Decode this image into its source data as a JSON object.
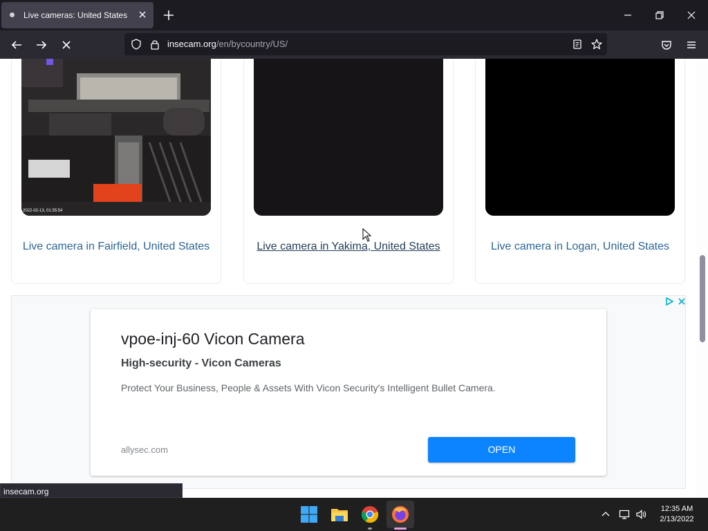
{
  "browser": {
    "tab_title": "Live cameras: United States",
    "url_domain": "insecam.org",
    "url_path": "/en/bycountry/US/"
  },
  "cameras": [
    {
      "label": "Live camera in Fairfield, United States",
      "overlay_timestamp": "2022-02-13, 01:35:54"
    },
    {
      "label": "Live camera in Yakima, United States"
    },
    {
      "label": "Live camera in Logan, United States"
    }
  ],
  "ad": {
    "title": "vpoe-inj-60 Vicon Camera",
    "subtitle": "High-security - Vicon Cameras",
    "description": "Protect Your Business, People & Assets With Vicon Security's Intelligent Bullet Camera.",
    "domain": "allysec.com",
    "button_label": "OPEN"
  },
  "status_bar": {
    "text": "insecam.org"
  },
  "taskbar": {
    "time": "12:35 AM",
    "date": "2/13/2022"
  },
  "colors": {
    "link": "#2a6496",
    "ad_button": "#0d84ff",
    "tab_bar": "#1c1b22",
    "nav_bar": "#2b2a33"
  }
}
